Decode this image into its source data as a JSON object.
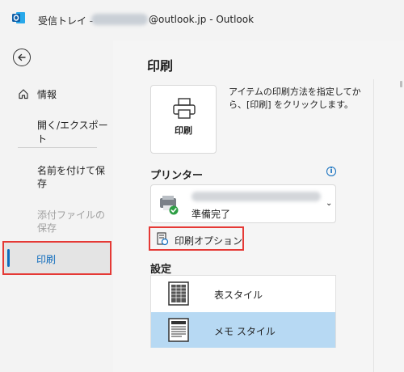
{
  "window": {
    "title_prefix": "受信トレイ -",
    "title_suffix": "@outlook.jp  -  Outlook"
  },
  "sidebar": {
    "back_icon": "arrow-left-icon",
    "info_label": "情報",
    "open_export_label": "開く/エクスポート",
    "save_as_label": "名前を付けて保存",
    "save_attachments_label": "添付ファイルの保存",
    "print_label": "印刷"
  },
  "main": {
    "title": "印刷",
    "print_button_label": "印刷",
    "print_description": "アイテムの印刷方法を指定してから、[印刷] をクリックします。",
    "printer_heading": "プリンター",
    "printer_status": "準備完了",
    "print_options_label": "印刷オプション",
    "settings_heading": "設定",
    "styles": [
      {
        "label": "表スタイル"
      },
      {
        "label": "メモ スタイル"
      }
    ]
  },
  "colors": {
    "accent": "#0f6cbd",
    "highlight": "#e53935",
    "selected": "#b7d9f3"
  }
}
